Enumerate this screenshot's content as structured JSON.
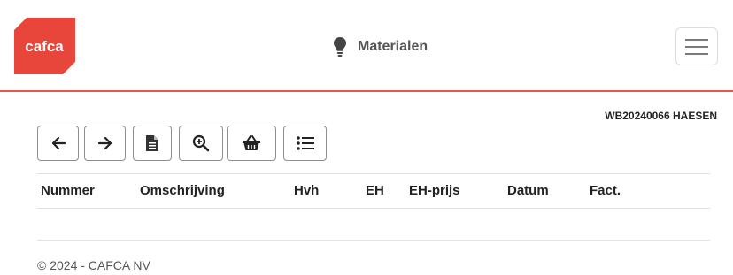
{
  "header": {
    "logo_text": "cafca",
    "title": "Materialen",
    "title_icon": "lightbulb-icon",
    "menu_icon": "hamburger-menu-icon",
    "accent_color": "#e8564a"
  },
  "document": {
    "id_label": "WB20240066 HAESEN"
  },
  "toolbar": {
    "buttons": [
      {
        "icon": "arrow-left-icon"
      },
      {
        "icon": "arrow-right-icon"
      },
      {
        "icon": "document-icon"
      },
      {
        "icon": "zoom-in-icon"
      },
      {
        "icon": "basket-icon"
      },
      {
        "icon": "list-icon"
      }
    ]
  },
  "table": {
    "columns": [
      "Nummer",
      "Omschrijving",
      "Hvh",
      "EH",
      "EH-prijs",
      "Datum",
      "Fact."
    ],
    "rows": []
  },
  "footer": {
    "copyright": "© 2024 - CAFCA NV"
  }
}
